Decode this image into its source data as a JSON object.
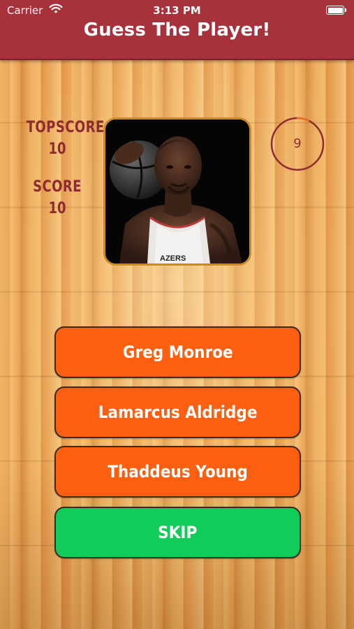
{
  "status_bar": {
    "carrier": "Carrier",
    "time": "3:13 PM",
    "wifi_icon": "wifi-icon",
    "battery_icon": "battery-icon"
  },
  "header": {
    "title": "Guess The Player!",
    "color": "#a8323c"
  },
  "scores": {
    "topscore_label": "TOPSCORE",
    "topscore_value": "10",
    "score_label": "SCORE",
    "score_value": "10",
    "color": "#8e2b30"
  },
  "player_photo": {
    "icon": "player-photo",
    "border_color": "#c88a26"
  },
  "timer": {
    "value": "9",
    "progress_fraction": 0.93,
    "color": "#8e2b30",
    "progress_color": "#e8702a"
  },
  "answers": [
    {
      "label": "Greg Monroe",
      "color": "#fb5f0f"
    },
    {
      "label": "Lamarcus Aldridge",
      "color": "#fb5f0f"
    },
    {
      "label": "Thaddeus Young",
      "color": "#fb5f0f"
    }
  ],
  "skip": {
    "label": "SKIP",
    "color": "#12cc59"
  }
}
